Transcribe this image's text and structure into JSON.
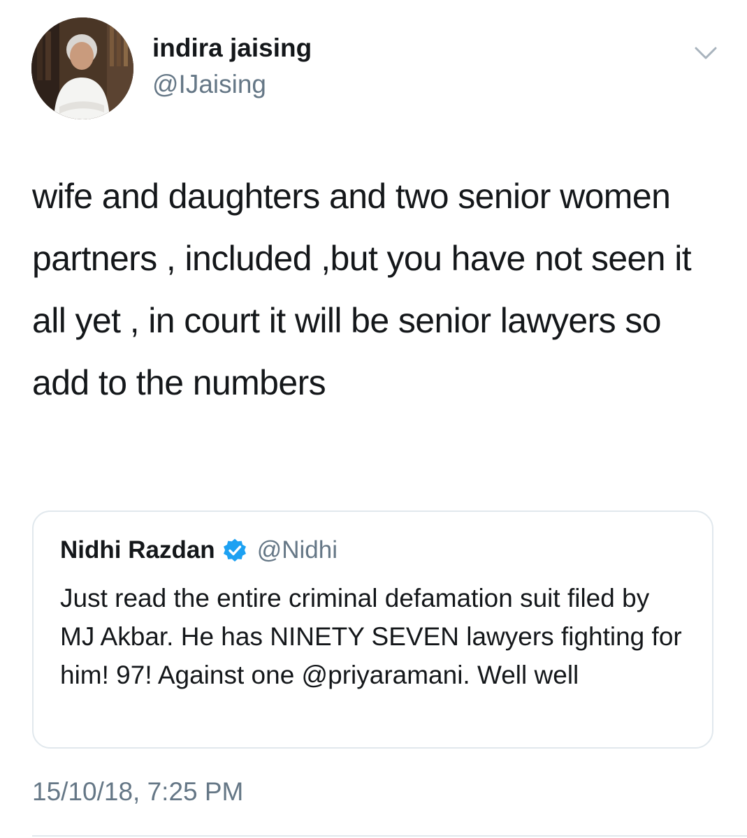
{
  "tweet": {
    "author": {
      "display_name": "indira jaising",
      "handle": "@IJaising",
      "avatar_icon": "profile-photo"
    },
    "menu_icon": "chevron-down-icon",
    "text": "wife and daughters and two senior women partners , included ,but you have not seen it all yet , in court it will be senior lawyers so add to the numbers",
    "quoted_tweet": {
      "display_name": "Nidhi Razdan",
      "verified": true,
      "verified_icon": "verified-badge-icon",
      "handle": "@Nidhi",
      "text": "Just read the entire criminal defamation suit filed by MJ Akbar. He has NINETY SEVEN lawyers fighting for him! 97! Against one @priyaramani. Well well"
    },
    "timestamp": "15/10/18, 7:25 PM"
  },
  "colors": {
    "primary_text": "#14171a",
    "secondary_text": "#657786",
    "border": "#e1e8ed",
    "verified_blue": "#1da1f2"
  }
}
